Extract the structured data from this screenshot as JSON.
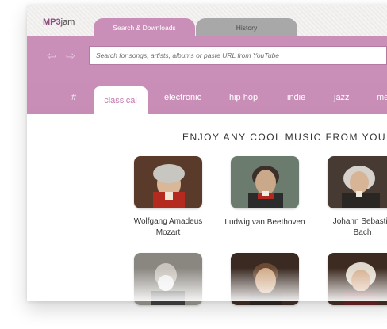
{
  "app": {
    "logo_prefix": "MP3",
    "logo_suffix": "jam"
  },
  "tabs": [
    {
      "label": "Search & Downloads",
      "active": true
    },
    {
      "label": "History",
      "active": false
    }
  ],
  "search": {
    "placeholder": "Search for songs, artists, albums or paste URL from YouTube"
  },
  "genres": [
    "#",
    "classical",
    "electronic",
    "hip hop",
    "indie",
    "jazz",
    "me"
  ],
  "active_genre": "classical",
  "headline": "ENJOY ANY COOL MUSIC FROM YOU",
  "artists": [
    {
      "name_line1": "Wolfgang Amadeus",
      "name_line2": "Mozart"
    },
    {
      "name_line1": "Ludwig van Beethoven",
      "name_line2": ""
    },
    {
      "name_line1": "Johann Sebastia",
      "name_line2": "Bach"
    },
    {
      "name_line1": "",
      "name_line2": ""
    },
    {
      "name_line1": "",
      "name_line2": ""
    },
    {
      "name_line1": "",
      "name_line2": ""
    }
  ],
  "colors": {
    "accent": "#c98fb8",
    "inactive_tab": "#a8a8a8",
    "logo": "#8d4d7f"
  }
}
